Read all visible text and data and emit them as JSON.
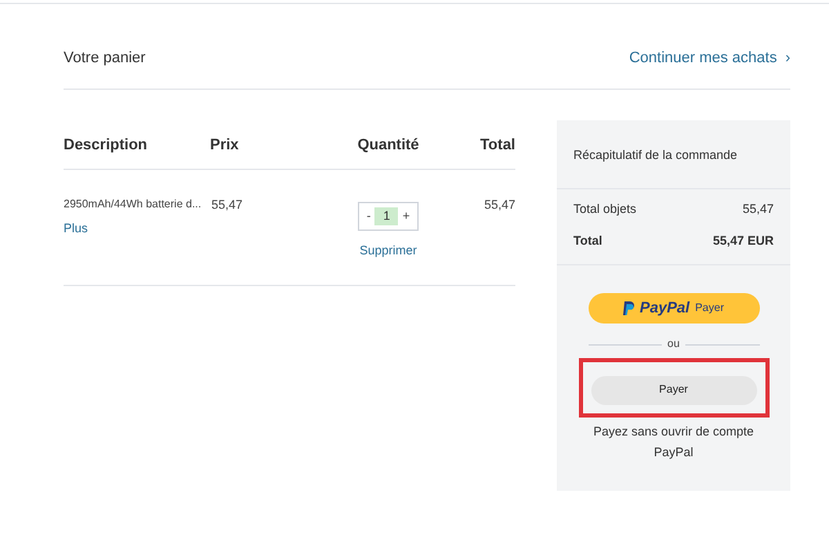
{
  "header": {
    "title": "Votre panier",
    "continue_link": "Continuer mes achats",
    "continue_arrow": "›"
  },
  "table": {
    "columns": [
      "Description",
      "Prix",
      "Quantité",
      "Total"
    ],
    "rows": [
      {
        "description": "2950mAh/44Wh batterie d...",
        "more": "Plus",
        "price": "55,47",
        "quantity": {
          "minus": "-",
          "value": "1",
          "plus": "+"
        },
        "remove": "Supprimer",
        "total": "55,47"
      }
    ]
  },
  "summary": {
    "title": "Récapitulatif de la commande",
    "lines": [
      {
        "label": "Total objets",
        "value": "55,47",
        "bold": false
      },
      {
        "label": "Total",
        "value": "55,47 EUR",
        "bold": true
      }
    ],
    "paypal_button": {
      "logo": "PayPal",
      "label": "Payer"
    },
    "separator": "ou",
    "pay_button": {
      "label": "Payer",
      "highlighted": true
    },
    "note": "Payez sans ouvrir de compte PayPal"
  }
}
